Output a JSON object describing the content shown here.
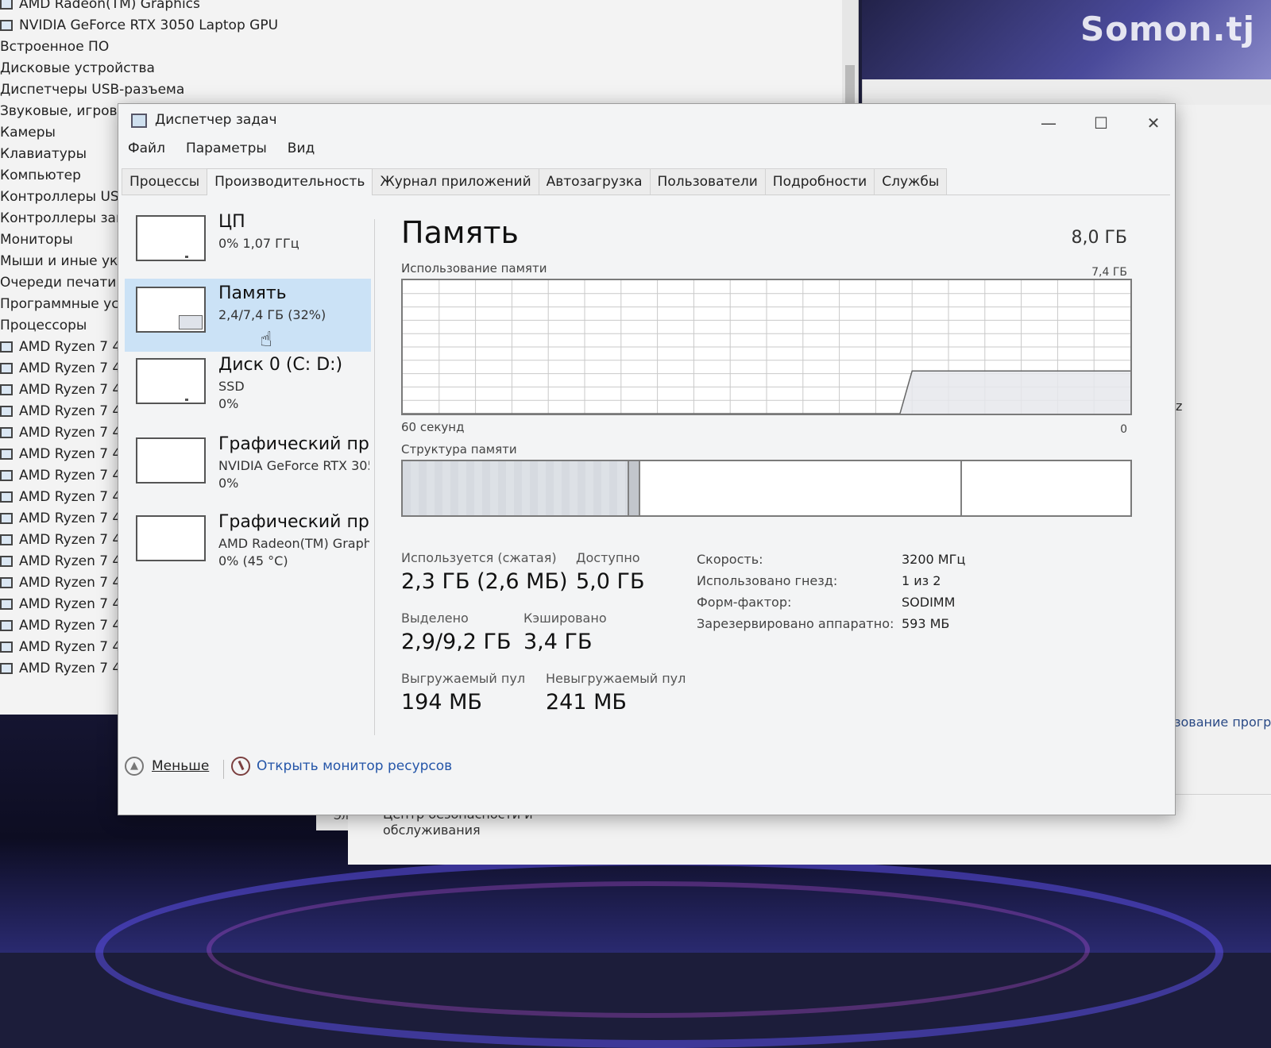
{
  "watermark": "Somon.tj",
  "device_manager": {
    "items": [
      {
        "label": "AMD Radeon(TM) Graphics",
        "indent": true
      },
      {
        "label": "NVIDIA GeForce RTX 3050 Laptop GPU",
        "indent": true
      },
      {
        "label": "Встроенное ПО",
        "indent": false
      },
      {
        "label": "Дисковые устройства",
        "indent": false
      },
      {
        "label": "Диспетчеры USB-разъема",
        "indent": false
      },
      {
        "label": "Звуковые, игровы",
        "indent": false
      },
      {
        "label": "Камеры",
        "indent": false
      },
      {
        "label": "Клавиатуры",
        "indent": false
      },
      {
        "label": "Компьютер",
        "indent": false
      },
      {
        "label": "Контроллеры USB",
        "indent": false
      },
      {
        "label": "Контроллеры зап",
        "indent": false
      },
      {
        "label": "Мониторы",
        "indent": false
      },
      {
        "label": "Мыши и иные ука",
        "indent": false
      },
      {
        "label": "Очереди печати",
        "indent": false
      },
      {
        "label": "Программные ус",
        "indent": false
      },
      {
        "label": "Процессоры",
        "indent": false
      },
      {
        "label": "AMD Ryzen 7 4",
        "indent": true
      },
      {
        "label": "AMD Ryzen 7 4",
        "indent": true
      },
      {
        "label": "AMD Ryzen 7 4",
        "indent": true
      },
      {
        "label": "AMD Ryzen 7 4",
        "indent": true
      },
      {
        "label": "AMD Ryzen 7 4",
        "indent": true
      },
      {
        "label": "AMD Ryzen 7 4",
        "indent": true
      },
      {
        "label": "AMD Ryzen 7 4",
        "indent": true
      },
      {
        "label": "AMD Ryzen 7 4",
        "indent": true
      },
      {
        "label": "AMD Ryzen 7 4",
        "indent": true
      },
      {
        "label": "AMD Ryzen 7 4",
        "indent": true
      },
      {
        "label": "AMD Ryzen 7 4",
        "indent": true
      },
      {
        "label": "AMD Ryzen 7 4",
        "indent": true
      },
      {
        "label": "AMD Ryzen 7 4",
        "indent": true
      },
      {
        "label": "AMD Ryzen 7 4",
        "indent": true
      },
      {
        "label": "AMD Ryzen 7 4",
        "indent": true
      },
      {
        "label": "AMD Ryzen 7 4",
        "indent": true
      }
    ]
  },
  "right_window": {
    "z_text": "z",
    "link_text": "зование прогр"
  },
  "bottom_window": {
    "tab_text": "Эл",
    "line1": "Центр безопасности и",
    "line2": "обслуживания"
  },
  "task_manager": {
    "title": "Диспетчер задач",
    "minimize": "—",
    "maximize": "☐",
    "close": "✕",
    "menu": [
      "Файл",
      "Параметры",
      "Вид"
    ],
    "tabs": [
      "Процессы",
      "Производительность",
      "Журнал приложений",
      "Автозагрузка",
      "Пользователи",
      "Подробности",
      "Службы"
    ],
    "active_tab": 1,
    "sidebar": [
      {
        "name": "ЦП",
        "sub": "0%  1,07 ГГц",
        "sub2": ""
      },
      {
        "name": "Память",
        "sub": "2,4/7,4 ГБ (32%)",
        "sub2": ""
      },
      {
        "name": "Диск 0 (C: D:)",
        "sub": "SSD",
        "sub2": "0%"
      },
      {
        "name": "Графический про",
        "sub": "NVIDIA GeForce RTX 305",
        "sub2": "0%"
      },
      {
        "name": "Графический про",
        "sub": "AMD Radeon(TM) Graph",
        "sub2": "0%  (45 °C)"
      }
    ],
    "active_sidebar": 1,
    "memory": {
      "title": "Память",
      "total": "8,0 ГБ",
      "usage_label": "Использование памяти",
      "usage_max": "7,4 ГБ",
      "time_label": "60 секунд",
      "time_end": "0",
      "structure_label": "Структура памяти",
      "usage_history_fraction": [
        0,
        0,
        0,
        0,
        0,
        0,
        0,
        0,
        0,
        0,
        0,
        0,
        0,
        0,
        0,
        0,
        0,
        0,
        0,
        0,
        0,
        0,
        0,
        0,
        0,
        0,
        0,
        0,
        0,
        0,
        0,
        0,
        0,
        0,
        0,
        0,
        0,
        0,
        0,
        0,
        0,
        0,
        0.32,
        0.32,
        0.32,
        0.32,
        0.32,
        0.32,
        0.32,
        0.32,
        0.32,
        0.32,
        0.32,
        0.32,
        0.32,
        0.32,
        0.32,
        0.32,
        0.32,
        0.32,
        0.32
      ],
      "stats": {
        "in_use_label": "Используется (сжатая)",
        "in_use_value": "2,3 ГБ (2,6 МБ)",
        "available_label": "Доступно",
        "available_value": "5,0 ГБ",
        "committed_label": "Выделено",
        "committed_value": "2,9/9,2 ГБ",
        "cached_label": "Кэшировано",
        "cached_value": "3,4 ГБ",
        "paged_label": "Выгружаемый пул",
        "paged_value": "194 МБ",
        "nonpaged_label": "Невыгружаемый пул",
        "nonpaged_value": "241 МБ"
      },
      "specs": [
        {
          "key": "Скорость:",
          "value": "3200 МГц"
        },
        {
          "key": "Использовано гнезд:",
          "value": "1 из 2"
        },
        {
          "key": "Форм-фактор:",
          "value": "SODIMM"
        },
        {
          "key": "Зарезервировано аппаратно:",
          "value": "593 МБ"
        }
      ]
    },
    "footer": {
      "fewer": "Меньше",
      "resource_monitor": "Открыть монитор ресурсов"
    }
  }
}
